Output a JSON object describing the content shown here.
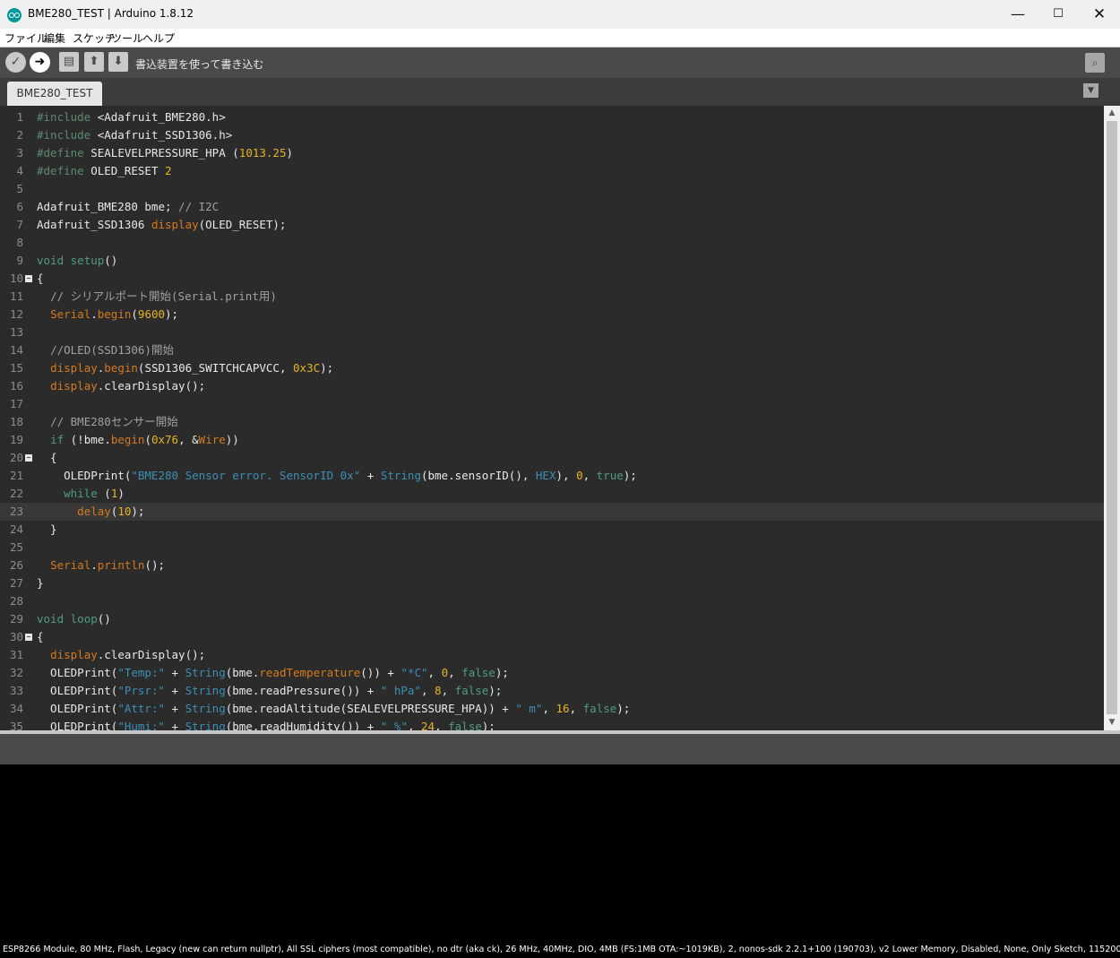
{
  "window": {
    "title": "BME280_TEST | Arduino 1.8.12",
    "minimize": "—",
    "maximize": "☐",
    "close": "✕"
  },
  "menu": [
    "ファイル",
    "編集",
    "スケッチ",
    "ツール",
    "ヘルプ"
  ],
  "toolbar": {
    "verify_icon": "✓",
    "upload_icon": "➜",
    "new_icon": "▤",
    "open_icon": "⬆",
    "save_icon": "⬇",
    "label": "書込装置を使って書き込む",
    "serial_monitor_icon": "⌕"
  },
  "tabs": [
    {
      "label": "BME280_TEST"
    }
  ],
  "tab_menu_icon": "▼",
  "editor": {
    "current_line": 23,
    "lines": [
      [
        [
          "#include ",
          "t-pre"
        ],
        [
          "<Adafruit_BME280.h>",
          ""
        ]
      ],
      [
        [
          "#include ",
          "t-pre"
        ],
        [
          "<Adafruit_SSD1306.h>",
          ""
        ]
      ],
      [
        [
          "#define ",
          "t-pre"
        ],
        [
          "SEALEVELPRESSURE_HPA (",
          ""
        ],
        [
          "1013.25",
          "t-num"
        ],
        [
          ")",
          ""
        ]
      ],
      [
        [
          "#define ",
          "t-pre"
        ],
        [
          "OLED_RESET ",
          ""
        ],
        [
          "2",
          "t-num"
        ]
      ],
      [],
      [
        [
          "Adafruit_BME280 bme; ",
          ""
        ],
        [
          "// I2C",
          "t-com"
        ]
      ],
      [
        [
          "Adafruit_SSD1306 ",
          ""
        ],
        [
          "display",
          "t-fn"
        ],
        [
          "(OLED_RESET);",
          ""
        ]
      ],
      [],
      [
        [
          "void ",
          "t-kw"
        ],
        [
          "setup",
          "t-kw"
        ],
        [
          "()",
          ""
        ]
      ],
      [
        [
          "{",
          ""
        ]
      ],
      [
        [
          "  ",
          ""
        ],
        [
          "// シリアルポート開始(Serial.print用)",
          "t-com"
        ]
      ],
      [
        [
          "  ",
          ""
        ],
        [
          "Serial",
          "t-cls"
        ],
        [
          ".",
          ""
        ],
        [
          "begin",
          "t-fn"
        ],
        [
          "(",
          ""
        ],
        [
          "9600",
          "t-num"
        ],
        [
          ");",
          ""
        ]
      ],
      [],
      [
        [
          "  ",
          ""
        ],
        [
          "//OLED(SSD1306)開始",
          "t-com"
        ]
      ],
      [
        [
          "  ",
          ""
        ],
        [
          "display",
          "t-fn"
        ],
        [
          ".",
          ""
        ],
        [
          "begin",
          "t-fn"
        ],
        [
          "(SSD1306_SWITCHCAPVCC, ",
          ""
        ],
        [
          "0x3C",
          "t-num"
        ],
        [
          ");",
          ""
        ]
      ],
      [
        [
          "  ",
          ""
        ],
        [
          "display",
          "t-fn"
        ],
        [
          ".clearDisplay();",
          ""
        ]
      ],
      [],
      [
        [
          "  ",
          ""
        ],
        [
          "// BME280センサー開始",
          "t-com"
        ]
      ],
      [
        [
          "  ",
          ""
        ],
        [
          "if",
          "t-kw"
        ],
        [
          " (!bme.",
          ""
        ],
        [
          "begin",
          "t-fn"
        ],
        [
          "(",
          ""
        ],
        [
          "0x76",
          "t-num"
        ],
        [
          ", &",
          ""
        ],
        [
          "Wire",
          "t-cls"
        ],
        [
          "))",
          ""
        ]
      ],
      [
        [
          "  {",
          ""
        ]
      ],
      [
        [
          "    OLEDPrint(",
          ""
        ],
        [
          "\"BME280 Sensor error. SensorID 0x\"",
          "t-str"
        ],
        [
          " + ",
          ""
        ],
        [
          "String",
          "t-str"
        ],
        [
          "(bme.sensorID(), ",
          ""
        ],
        [
          "HEX",
          "t-str"
        ],
        [
          "), ",
          ""
        ],
        [
          "0",
          "t-num"
        ],
        [
          ", ",
          ""
        ],
        [
          "true",
          "t-kw"
        ],
        [
          ");",
          ""
        ]
      ],
      [
        [
          "    ",
          ""
        ],
        [
          "while",
          "t-kw"
        ],
        [
          " (",
          ""
        ],
        [
          "1",
          "t-num"
        ],
        [
          ")",
          ""
        ]
      ],
      [
        [
          "      ",
          ""
        ],
        [
          "delay",
          "t-fn"
        ],
        [
          "(",
          ""
        ],
        [
          "10",
          "t-num"
        ],
        [
          ");",
          ""
        ]
      ],
      [
        [
          "  }",
          ""
        ]
      ],
      [],
      [
        [
          "  ",
          ""
        ],
        [
          "Serial",
          "t-cls"
        ],
        [
          ".",
          ""
        ],
        [
          "println",
          "t-fn"
        ],
        [
          "();",
          ""
        ]
      ],
      [
        [
          "}",
          ""
        ]
      ],
      [],
      [
        [
          "void ",
          "t-kw"
        ],
        [
          "loop",
          "t-kw"
        ],
        [
          "()",
          ""
        ]
      ],
      [
        [
          "{",
          ""
        ]
      ],
      [
        [
          "  ",
          ""
        ],
        [
          "display",
          "t-fn"
        ],
        [
          ".clearDisplay();",
          ""
        ]
      ],
      [
        [
          "  OLEDPrint(",
          ""
        ],
        [
          "\"Temp:\"",
          "t-str"
        ],
        [
          " + ",
          ""
        ],
        [
          "String",
          "t-str"
        ],
        [
          "(bme.",
          ""
        ],
        [
          "readTemperature",
          "t-fn"
        ],
        [
          "()) + ",
          ""
        ],
        [
          "\"*C\"",
          "t-str"
        ],
        [
          ", ",
          ""
        ],
        [
          "0",
          "t-num"
        ],
        [
          ", ",
          ""
        ],
        [
          "false",
          "t-kw"
        ],
        [
          ");",
          ""
        ]
      ],
      [
        [
          "  OLEDPrint(",
          ""
        ],
        [
          "\"Prsr:\"",
          "t-str"
        ],
        [
          " + ",
          ""
        ],
        [
          "String",
          "t-str"
        ],
        [
          "(bme.readPressure()) + ",
          ""
        ],
        [
          "\" hPa\"",
          "t-str"
        ],
        [
          ", ",
          ""
        ],
        [
          "8",
          "t-num"
        ],
        [
          ", ",
          ""
        ],
        [
          "false",
          "t-kw"
        ],
        [
          ");",
          ""
        ]
      ],
      [
        [
          "  OLEDPrint(",
          ""
        ],
        [
          "\"Attr:\"",
          "t-str"
        ],
        [
          " + ",
          ""
        ],
        [
          "String",
          "t-str"
        ],
        [
          "(bme.readAltitude(SEALEVELPRESSURE_HPA)) + ",
          ""
        ],
        [
          "\" m\"",
          "t-str"
        ],
        [
          ", ",
          ""
        ],
        [
          "16",
          "t-num"
        ],
        [
          ", ",
          ""
        ],
        [
          "false",
          "t-kw"
        ],
        [
          ");",
          ""
        ]
      ],
      [
        [
          "  OLEDPrint(",
          ""
        ],
        [
          "\"Humi:\"",
          "t-str"
        ],
        [
          " + ",
          ""
        ],
        [
          "String",
          "t-str"
        ],
        [
          "(bme.readHumidity()) + ",
          ""
        ],
        [
          "\" %\"",
          "t-str"
        ],
        [
          ", ",
          ""
        ],
        [
          "24",
          "t-num"
        ],
        [
          ", ",
          ""
        ],
        [
          "false",
          "t-kw"
        ],
        [
          ");",
          ""
        ]
      ]
    ],
    "fold_lines": [
      10,
      20,
      30
    ],
    "fold_icon": "−"
  },
  "scrollbar": {
    "up_icon": "▲",
    "down_icon": "▼"
  },
  "status": {
    "board_info": "ESP8266 Module, 80 MHz, Flash, Legacy (new can return nullptr), All SSL ciphers (most compatible), no dtr (aka ck), 26 MHz, 40MHz, DIO, 4MB (FS:1MB OTA:~1019KB), 2, nonos-sdk 2.2.1+100 (190703), v2 Lower Memory, Disabled, None, Only Sketch, 115200"
  }
}
